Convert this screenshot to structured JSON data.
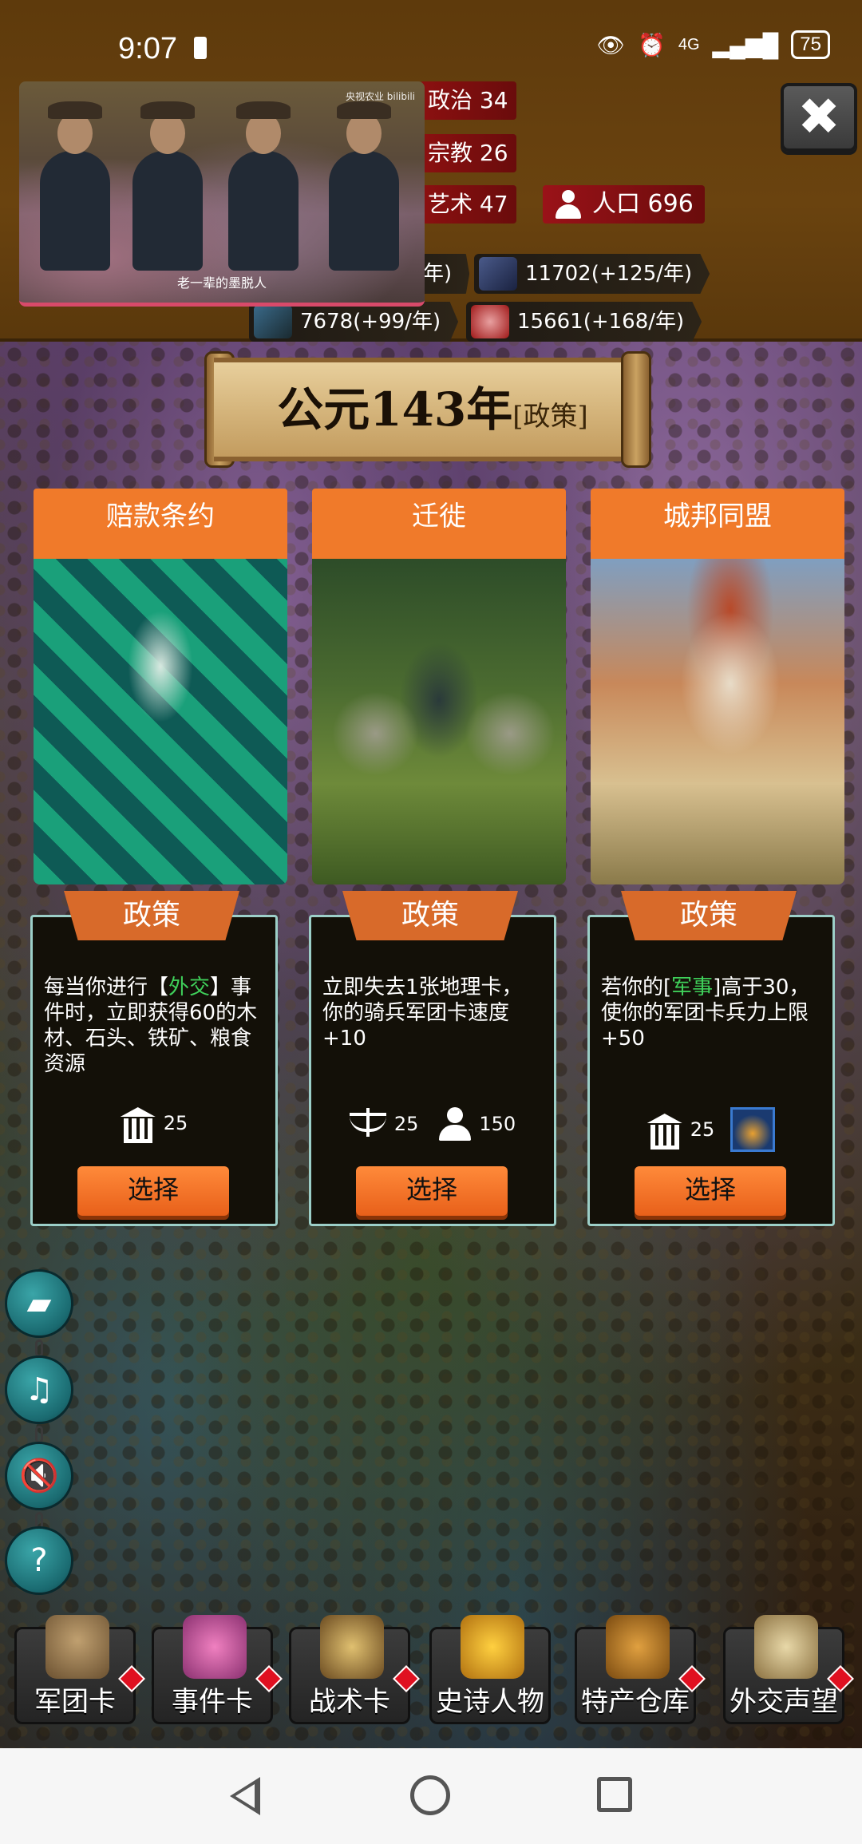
{
  "status_bar": {
    "time": "9:07",
    "network": "4G",
    "battery": "75"
  },
  "video": {
    "logo": "央视农业 bilibili",
    "caption": "老一辈的墨脱人"
  },
  "stats": {
    "politics": "政治 34",
    "religion": "宗教 26",
    "art": "艺术 47",
    "population": "人口 696"
  },
  "resources": {
    "r1": "年)",
    "r2": "11702(+125/年)",
    "r3": "7678(+99/年)",
    "r4": "15661(+168/年)"
  },
  "banner": {
    "title": "公元143年",
    "subtitle": "[政策]"
  },
  "cards": [
    {
      "title": "赔款条约",
      "tag": "政策",
      "desc_pre": "每当你进行【",
      "desc_hl": "外交",
      "desc_post": "】事件时，立即获得60的木材、石头、铁矿、粮食资源",
      "cost1": "25",
      "button": "选择"
    },
    {
      "title": "迁徙",
      "tag": "政策",
      "desc_pre": "立即失去1张地理卡，你的骑兵军团卡速度+10",
      "desc_hl": "",
      "desc_post": "",
      "cost1": "25",
      "cost2": "150",
      "button": "选择"
    },
    {
      "title": "城邦同盟",
      "tag": "政策",
      "desc_pre": "若你的[",
      "desc_hl": "军事",
      "desc_post": "]高于30，使你的军团卡兵力上限+50",
      "cost1": "25",
      "button": "选择"
    }
  ],
  "side_buttons": [
    "book-icon",
    "no-music-icon",
    "mute-icon",
    "help-icon"
  ],
  "tabs": [
    {
      "label": "军团卡",
      "icon": "helmet-icon"
    },
    {
      "label": "事件卡",
      "icon": "scroll-icon"
    },
    {
      "label": "战术卡",
      "icon": "shield-icon"
    },
    {
      "label": "史诗人物",
      "icon": "crown-icon"
    },
    {
      "label": "特产仓库",
      "icon": "chest-icon"
    },
    {
      "label": "外交声望",
      "icon": "letter-icon"
    }
  ],
  "colors": {
    "accent_orange": "#f07a2a",
    "highlight_green": "#3fd05a",
    "stat_red": "#8c1010",
    "card_border": "#9ccfc8"
  }
}
